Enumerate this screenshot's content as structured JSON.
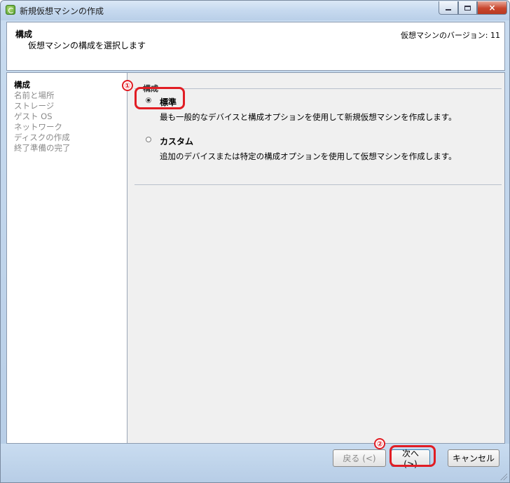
{
  "window": {
    "title": "新規仮想マシンの作成",
    "controls": {
      "minimize": "min-icon",
      "maximize": "max-icon",
      "close": "×"
    }
  },
  "header": {
    "title": "構成",
    "subtitle": "仮想マシンの構成を選択します",
    "version": "仮想マシンのバージョン: 11"
  },
  "sidebar": {
    "steps": [
      {
        "label": "構成",
        "active": true
      },
      {
        "label": "名前と場所",
        "active": false
      },
      {
        "label": "ストレージ",
        "active": false
      },
      {
        "label": "ゲスト OS",
        "active": false
      },
      {
        "label": "ネットワーク",
        "active": false
      },
      {
        "label": "ディスクの作成",
        "active": false
      },
      {
        "label": "終了準備の完了",
        "active": false
      }
    ]
  },
  "config": {
    "group_label": "構成",
    "options": [
      {
        "label": "標準",
        "description": "最も一般的なデバイスと構成オプションを使用して新規仮想マシンを作成します。",
        "selected": true
      },
      {
        "label": "カスタム",
        "description": "追加のデバイスまたは特定の構成オプションを使用して仮想マシンを作成します。",
        "selected": false
      }
    ]
  },
  "buttons": {
    "back": "戻る (<)",
    "next": "次へ (>)",
    "cancel": "キャンセル"
  },
  "annotations": {
    "step1": "①",
    "step2": "②",
    "color": "#e11d24"
  }
}
